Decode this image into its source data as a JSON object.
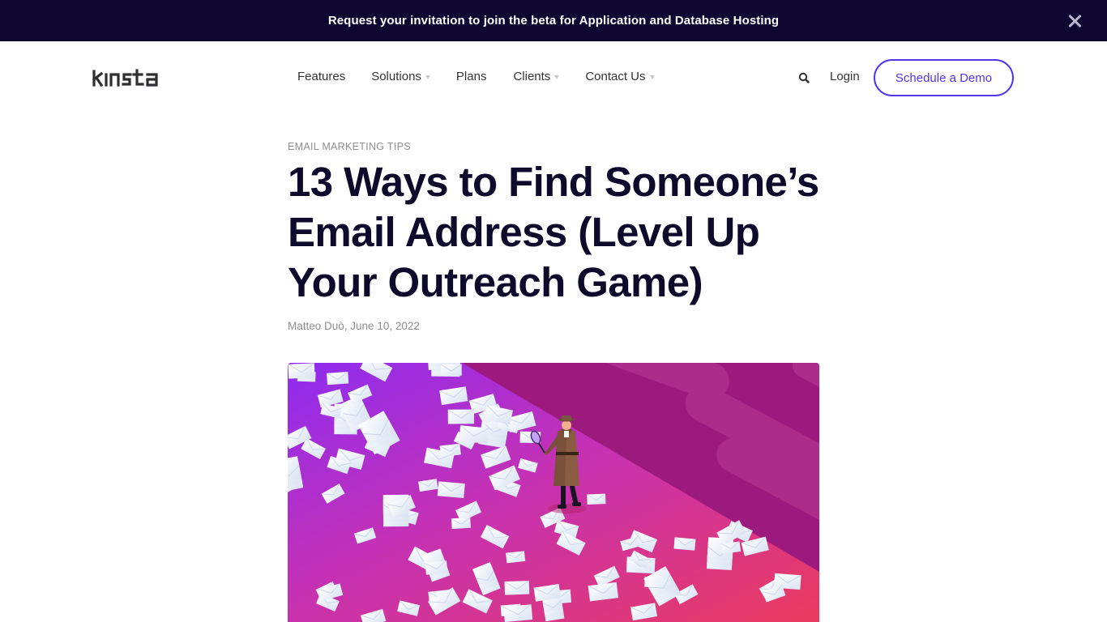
{
  "announcement": {
    "text": "Request your invitation to join the beta for Application and Database Hosting",
    "close_icon": "close-icon"
  },
  "header": {
    "logo_text": "kinsta",
    "nav": [
      {
        "label": "Features",
        "has_dropdown": false
      },
      {
        "label": "Solutions",
        "has_dropdown": true
      },
      {
        "label": "Plans",
        "has_dropdown": false
      },
      {
        "label": "Clients",
        "has_dropdown": true
      },
      {
        "label": "Contact Us",
        "has_dropdown": true
      }
    ],
    "search_icon": "search-icon",
    "login_label": "Login",
    "demo_label": "Schedule a Demo"
  },
  "article": {
    "category": "Email Marketing Tips",
    "title": "13 Ways to Find Someone’s Email Address (Level Up Your Outreach Game)",
    "author": "Matteo Duò",
    "date": "June 10, 2022",
    "meta_text": "Matteo Duò, June 10, 2022",
    "hero_image_alt": "Illustration of a detective with a magnifying glass among scattered envelopes"
  },
  "colors": {
    "announce_bg": "#0e0530",
    "title_text": "#0e0a2c",
    "accent": "#5333ed",
    "muted_text": "#8d8d93",
    "hero_gradient_start": "#8e2cf0",
    "hero_gradient_end": "#e63a64",
    "hero_wall": "#9c1a7e"
  }
}
